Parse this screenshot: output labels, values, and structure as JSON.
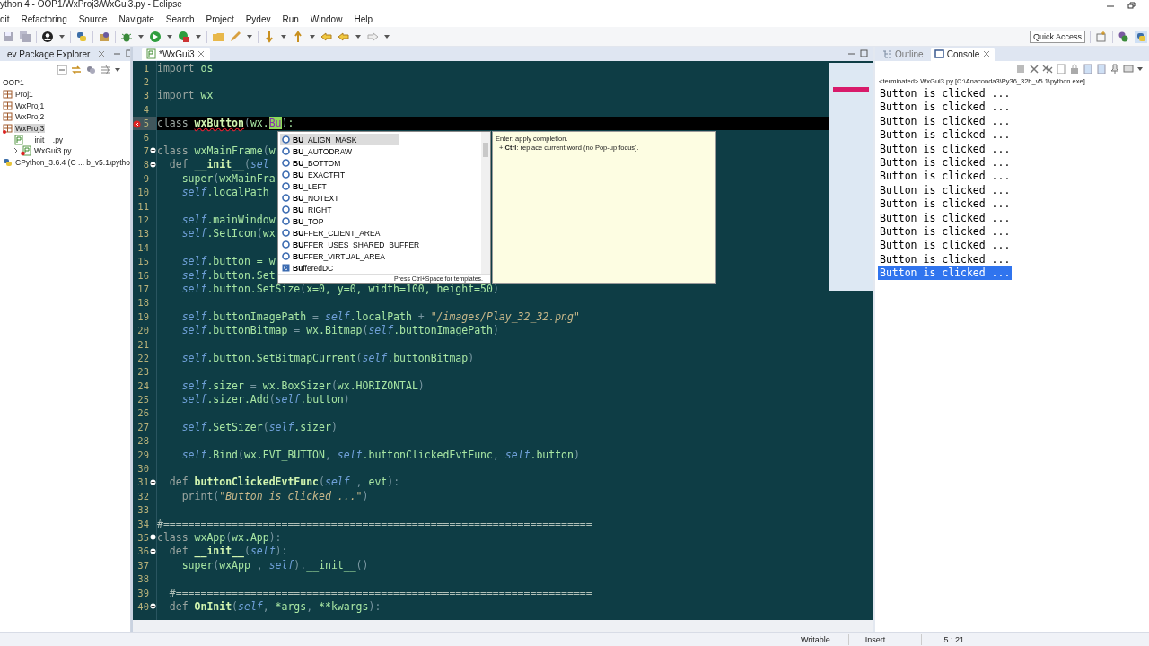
{
  "window": {
    "title": "ython 4 - OOP1/WxProj3/WxGui3.py - Eclipse"
  },
  "menu": [
    "dit",
    "Refactoring",
    "Source",
    "Navigate",
    "Search",
    "Project",
    "Pydev",
    "Run",
    "Window",
    "Help"
  ],
  "toolbar": {
    "quick_access": "Quick Access"
  },
  "explorer": {
    "title": "ev Package Explorer",
    "tree": [
      {
        "label": "OOP1",
        "kind": "working-set",
        "selected": false,
        "error": false,
        "children": [
          {
            "label": "Proj1",
            "kind": "project",
            "selected": false,
            "error": false
          },
          {
            "label": "WxProj1",
            "kind": "project",
            "selected": false,
            "error": false
          },
          {
            "label": "WxProj2",
            "kind": "project",
            "selected": false,
            "error": false
          },
          {
            "label": "WxProj3",
            "kind": "project",
            "selected": true,
            "error": true,
            "children": [
              {
                "label": "__init__.py",
                "kind": "file",
                "selected": false,
                "error": false
              },
              {
                "label": "WxGui3.py",
                "kind": "file",
                "selected": false,
                "error": true,
                "expandable": true
              }
            ]
          },
          {
            "label": "CPython_3.6.4  (C ... b_v5.1\\pytho",
            "kind": "interpreter",
            "selected": false,
            "error": false
          }
        ]
      }
    ]
  },
  "editor": {
    "tab": "*WxGui3",
    "lines": [
      {
        "no": "1",
        "fold": false,
        "tokens": [
          {
            "kind": "keyword",
            "text": "import "
          },
          {
            "kind": "name",
            "text": "os"
          }
        ]
      },
      {
        "no": "2",
        "fold": false
      },
      {
        "no": "3",
        "fold": false,
        "tokens": [
          {
            "kind": "keyword",
            "text": "import "
          },
          {
            "kind": "name",
            "text": "wx"
          }
        ]
      },
      {
        "no": "4",
        "fold": false
      },
      {
        "no": "5",
        "fold": false,
        "current": true,
        "error": true,
        "tokens": [
          {
            "kind": "keyword",
            "text": "class "
          },
          {
            "kind": "squiggle",
            "text": "wxButton"
          },
          {
            "kind": "punct",
            "text": "("
          },
          {
            "kind": "name",
            "text": "wx."
          },
          {
            "kind": "match",
            "text": "Bu"
          },
          {
            "kind": "punct",
            "text": ")"
          },
          {
            "kind": "name",
            "text": ":"
          }
        ]
      },
      {
        "no": "6",
        "fold": false
      },
      {
        "no": "7",
        "fold": true,
        "tokens": [
          {
            "kind": "keyword",
            "text": "class "
          },
          {
            "kind": "name",
            "text": "wxMainFrame"
          },
          {
            "kind": "punct",
            "text": "("
          },
          {
            "kind": "name",
            "text": "w"
          }
        ]
      },
      {
        "no": "8",
        "fold": true,
        "tokens": [
          {
            "kind": "keyword",
            "text": "  def "
          },
          {
            "kind": "func",
            "text": "__init__"
          },
          {
            "kind": "punct",
            "text": "("
          },
          {
            "kind": "self",
            "text": "sel"
          }
        ]
      },
      {
        "no": "9",
        "fold": false,
        "tokens": [
          {
            "kind": "name",
            "text": "    super"
          },
          {
            "kind": "punct",
            "text": "("
          },
          {
            "kind": "name",
            "text": "wxMainFra"
          }
        ]
      },
      {
        "no": "10",
        "fold": false,
        "tokens": [
          {
            "kind": "self",
            "text": "    self"
          },
          {
            "kind": "name",
            "text": ".localPath"
          }
        ]
      },
      {
        "no": "11",
        "fold": false
      },
      {
        "no": "12",
        "fold": false,
        "tokens": [
          {
            "kind": "self",
            "text": "    self"
          },
          {
            "kind": "name",
            "text": ".mainWindow"
          }
        ]
      },
      {
        "no": "13",
        "fold": false,
        "tokens": [
          {
            "kind": "self",
            "text": "    self"
          },
          {
            "kind": "name",
            "text": ".SetIcon"
          },
          {
            "kind": "punct",
            "text": "("
          },
          {
            "kind": "name",
            "text": "wx"
          }
        ]
      },
      {
        "no": "14",
        "fold": false
      },
      {
        "no": "15",
        "fold": false,
        "tokens": [
          {
            "kind": "self",
            "text": "    self"
          },
          {
            "kind": "name",
            "text": ".button = w"
          }
        ]
      },
      {
        "no": "16",
        "fold": false,
        "tokens": [
          {
            "kind": "self",
            "text": "    self"
          },
          {
            "kind": "name",
            "text": ".button.Set"
          }
        ]
      },
      {
        "no": "17",
        "fold": false,
        "tokens": [
          {
            "kind": "self",
            "text": "    self"
          },
          {
            "kind": "name",
            "text": ".button.SetSize"
          },
          {
            "kind": "punct",
            "text": "("
          },
          {
            "kind": "name",
            "text": "x=0, y=0, width=100, height=50"
          },
          {
            "kind": "punct",
            "text": ")"
          }
        ]
      },
      {
        "no": "18",
        "fold": false
      },
      {
        "no": "19",
        "fold": false,
        "tokens": [
          {
            "kind": "self",
            "text": "    self"
          },
          {
            "kind": "name",
            "text": ".buttonImagePath "
          },
          {
            "kind": "punct",
            "text": "= "
          },
          {
            "kind": "self",
            "text": "self"
          },
          {
            "kind": "name",
            "text": ".localPath "
          },
          {
            "kind": "punct",
            "text": "+ "
          },
          {
            "kind": "string",
            "text": "\"/images/Play_32_32.png\""
          }
        ]
      },
      {
        "no": "20",
        "fold": false,
        "tokens": [
          {
            "kind": "self",
            "text": "    self"
          },
          {
            "kind": "name",
            "text": ".buttonBitmap "
          },
          {
            "kind": "punct",
            "text": "= "
          },
          {
            "kind": "name",
            "text": "wx.Bitmap"
          },
          {
            "kind": "punct",
            "text": "("
          },
          {
            "kind": "self",
            "text": "self"
          },
          {
            "kind": "name",
            "text": ".buttonImagePath"
          },
          {
            "kind": "punct",
            "text": ")"
          }
        ]
      },
      {
        "no": "21",
        "fold": false
      },
      {
        "no": "22",
        "fold": false,
        "tokens": [
          {
            "kind": "self",
            "text": "    self"
          },
          {
            "kind": "name",
            "text": ".button.SetBitmapCurrent"
          },
          {
            "kind": "punct",
            "text": "("
          },
          {
            "kind": "self",
            "text": "self"
          },
          {
            "kind": "name",
            "text": ".buttonBitmap"
          },
          {
            "kind": "punct",
            "text": ")"
          }
        ]
      },
      {
        "no": "23",
        "fold": false
      },
      {
        "no": "24",
        "fold": false,
        "tokens": [
          {
            "kind": "self",
            "text": "    self"
          },
          {
            "kind": "name",
            "text": ".sizer "
          },
          {
            "kind": "punct",
            "text": "= "
          },
          {
            "kind": "name",
            "text": "wx.BoxSizer"
          },
          {
            "kind": "punct",
            "text": "("
          },
          {
            "kind": "name",
            "text": "wx.HORIZONTAL"
          },
          {
            "kind": "punct",
            "text": ")"
          }
        ]
      },
      {
        "no": "25",
        "fold": false,
        "tokens": [
          {
            "kind": "self",
            "text": "    self"
          },
          {
            "kind": "name",
            "text": ".sizer.Add"
          },
          {
            "kind": "punct",
            "text": "("
          },
          {
            "kind": "self",
            "text": "self"
          },
          {
            "kind": "name",
            "text": ".button"
          },
          {
            "kind": "punct",
            "text": ")"
          }
        ]
      },
      {
        "no": "26",
        "fold": false
      },
      {
        "no": "27",
        "fold": false,
        "tokens": [
          {
            "kind": "self",
            "text": "    self"
          },
          {
            "kind": "name",
            "text": ".SetSizer"
          },
          {
            "kind": "punct",
            "text": "("
          },
          {
            "kind": "self",
            "text": "self"
          },
          {
            "kind": "name",
            "text": ".sizer"
          },
          {
            "kind": "punct",
            "text": ")"
          }
        ]
      },
      {
        "no": "28",
        "fold": false
      },
      {
        "no": "29",
        "fold": false,
        "tokens": [
          {
            "kind": "self",
            "text": "    self"
          },
          {
            "kind": "name",
            "text": ".Bind"
          },
          {
            "kind": "punct",
            "text": "("
          },
          {
            "kind": "name",
            "text": "wx.EVT_BUTTON"
          },
          {
            "kind": "punct",
            "text": ", "
          },
          {
            "kind": "self",
            "text": "self"
          },
          {
            "kind": "name",
            "text": ".buttonClickedEvtFunc"
          },
          {
            "kind": "punct",
            "text": ", "
          },
          {
            "kind": "self",
            "text": "self"
          },
          {
            "kind": "name",
            "text": ".button"
          },
          {
            "kind": "punct",
            "text": ")"
          }
        ]
      },
      {
        "no": "30",
        "fold": false
      },
      {
        "no": "31",
        "fold": true,
        "tokens": [
          {
            "kind": "keyword",
            "text": "  def "
          },
          {
            "kind": "func",
            "text": "buttonClickedEvtFunc"
          },
          {
            "kind": "punct",
            "text": "("
          },
          {
            "kind": "self",
            "text": "self"
          },
          {
            "kind": "punct",
            "text": " , "
          },
          {
            "kind": "name",
            "text": "evt"
          },
          {
            "kind": "punct",
            "text": "):"
          }
        ]
      },
      {
        "no": "32",
        "fold": false,
        "tokens": [
          {
            "kind": "keyword",
            "text": "    print"
          },
          {
            "kind": "punct",
            "text": "("
          },
          {
            "kind": "string",
            "text": "\"Button is clicked ...\""
          },
          {
            "kind": "punct",
            "text": ")"
          }
        ]
      },
      {
        "no": "33",
        "fold": false
      },
      {
        "no": "34",
        "fold": false,
        "tokens": [
          {
            "kind": "comment",
            "text": "#====================================================================="
          }
        ]
      },
      {
        "no": "35",
        "fold": true,
        "tokens": [
          {
            "kind": "keyword",
            "text": "class "
          },
          {
            "kind": "name",
            "text": "wxApp"
          },
          {
            "kind": "punct",
            "text": "("
          },
          {
            "kind": "name",
            "text": "wx.App"
          },
          {
            "kind": "punct",
            "text": "):"
          }
        ]
      },
      {
        "no": "36",
        "fold": true,
        "tokens": [
          {
            "kind": "keyword",
            "text": "  def "
          },
          {
            "kind": "func",
            "text": "__init__"
          },
          {
            "kind": "punct",
            "text": "("
          },
          {
            "kind": "self",
            "text": "self"
          },
          {
            "kind": "punct",
            "text": "):"
          }
        ]
      },
      {
        "no": "37",
        "fold": false,
        "tokens": [
          {
            "kind": "name",
            "text": "    super"
          },
          {
            "kind": "punct",
            "text": "("
          },
          {
            "kind": "name",
            "text": "wxApp"
          },
          {
            "kind": "punct",
            "text": " , "
          },
          {
            "kind": "self",
            "text": "self"
          },
          {
            "kind": "punct",
            "text": ")."
          },
          {
            "kind": "name",
            "text": "__init__"
          },
          {
            "kind": "punct",
            "text": "()"
          }
        ]
      },
      {
        "no": "38",
        "fold": false
      },
      {
        "no": "39",
        "fold": false,
        "tokens": [
          {
            "kind": "comment",
            "text": "  #==================================================================="
          }
        ]
      },
      {
        "no": "40",
        "fold": true,
        "tokens": [
          {
            "kind": "keyword",
            "text": "  def "
          },
          {
            "kind": "func",
            "text": "OnInit"
          },
          {
            "kind": "punct",
            "text": "("
          },
          {
            "kind": "self",
            "text": "self"
          },
          {
            "kind": "punct",
            "text": ", "
          },
          {
            "kind": "name",
            "text": "*args"
          },
          {
            "kind": "punct",
            "text": ", "
          },
          {
            "kind": "name",
            "text": "**kwargs"
          },
          {
            "kind": "punct",
            "text": "):"
          }
        ]
      }
    ],
    "completion": {
      "items": [
        {
          "label": "**BU**_ALIGN_MASK",
          "kind": "constant",
          "selected": true
        },
        {
          "label": "**BU**_AUTODRAW",
          "kind": "constant",
          "selected": false
        },
        {
          "label": "**BU**_BOTTOM",
          "kind": "constant",
          "selected": false
        },
        {
          "label": "**BU**_EXACTFIT",
          "kind": "constant",
          "selected": false
        },
        {
          "label": "**BU**_LEFT",
          "kind": "constant",
          "selected": false
        },
        {
          "label": "**BU**_NOTEXT",
          "kind": "constant",
          "selected": false
        },
        {
          "label": "**BU**_RIGHT",
          "kind": "constant",
          "selected": false
        },
        {
          "label": "**BU**_TOP",
          "kind": "constant",
          "selected": false
        },
        {
          "label": "**BU**FFER_CLIENT_AREA",
          "kind": "constant",
          "selected": false
        },
        {
          "label": "**BU**FFER_USES_SHARED_BUFFER",
          "kind": "constant",
          "selected": false
        },
        {
          "label": "**BU**FFER_VIRTUAL_AREA",
          "kind": "constant",
          "selected": false
        },
        {
          "label": "**Bu**fferedDC",
          "kind": "class",
          "selected": false
        }
      ],
      "footer": "Press Ctrl+Space for templates.",
      "help": [
        "Enter: apply completion.",
        "+ **Ctrl**: replace current word (no Pop-up focus)."
      ]
    }
  },
  "console": {
    "tabs": [
      {
        "label": "Outline",
        "selected": false
      },
      {
        "label": "Console",
        "selected": true
      }
    ],
    "process": "<terminated> WxGui3.py [C:\\Anaconda3\\Py36_32b_v5.1\\python.exe]",
    "lines": [
      {
        "text": "Button is clicked ...",
        "selected": false
      },
      {
        "text": "Button is clicked ...",
        "selected": false
      },
      {
        "text": "Button is clicked ...",
        "selected": false
      },
      {
        "text": "Button is clicked ...",
        "selected": false
      },
      {
        "text": "Button is clicked ...",
        "selected": false
      },
      {
        "text": "Button is clicked ...",
        "selected": false
      },
      {
        "text": "Button is clicked ...",
        "selected": false
      },
      {
        "text": "Button is clicked ...",
        "selected": false
      },
      {
        "text": "Button is clicked ...",
        "selected": false
      },
      {
        "text": "Button is clicked ...",
        "selected": false
      },
      {
        "text": "Button is clicked ...",
        "selected": false
      },
      {
        "text": "Button is clicked ...",
        "selected": false
      },
      {
        "text": "Button is clicked ...",
        "selected": false
      },
      {
        "text": "Button is clicked ...",
        "selected": true
      }
    ]
  },
  "status_bar": [
    "Writable",
    "Insert",
    "5 : 21"
  ]
}
